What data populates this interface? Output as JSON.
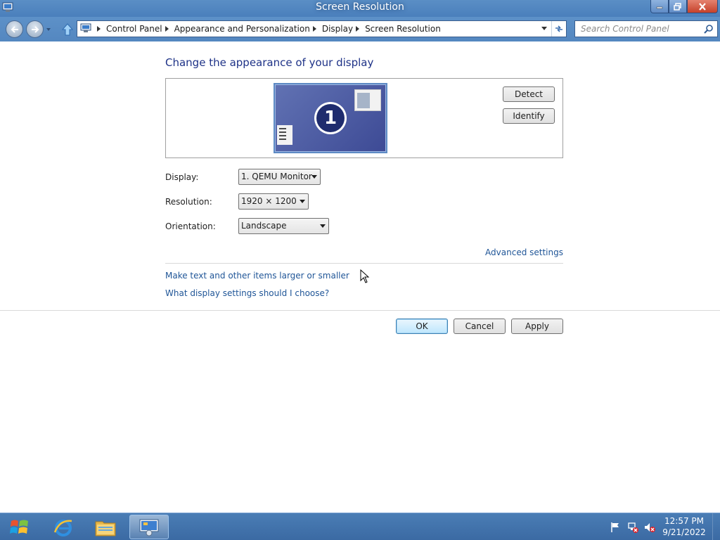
{
  "window": {
    "title": "Screen Resolution"
  },
  "address_bar": {
    "breadcrumbs": [
      "Control Panel",
      "Appearance and Personalization",
      "Display",
      "Screen Resolution"
    ]
  },
  "search": {
    "placeholder": "Search Control Panel"
  },
  "main": {
    "heading": "Change the appearance of your display",
    "monitor_number": "1",
    "detect_label": "Detect",
    "identify_label": "Identify",
    "display_label": "Display:",
    "display_value": "1. QEMU Monitor",
    "resolution_label": "Resolution:",
    "resolution_value": "1920 × 1200",
    "orientation_label": "Orientation:",
    "orientation_value": "Landscape",
    "advanced_link": "Advanced settings",
    "links": [
      "Make text and other items larger or smaller",
      "What display settings should I choose?"
    ]
  },
  "dialog_buttons": {
    "ok": "OK",
    "cancel": "Cancel",
    "apply": "Apply"
  },
  "taskbar": {
    "time": "12:57 PM",
    "date": "9/21/2022",
    "items": [
      "start-orb-icon",
      "internet-explorer-icon",
      "file-explorer-icon",
      "display-settings-icon"
    ]
  },
  "colors": {
    "heading": "#1e3287",
    "link": "#1f5597",
    "titlebar": "#4a7fbc",
    "taskbar": "#3b6aa3"
  }
}
